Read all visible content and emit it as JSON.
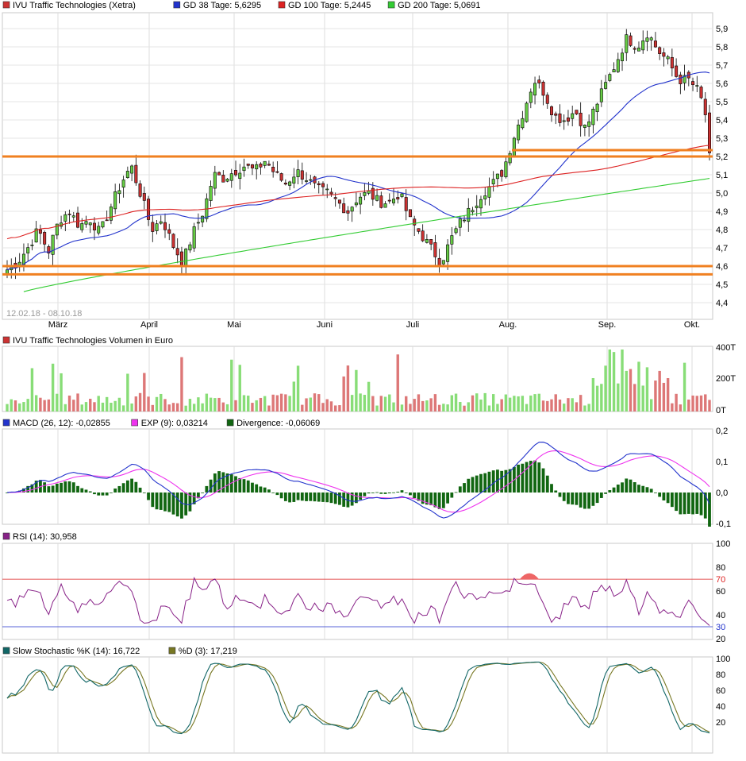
{
  "colors": {
    "up": "#66cc44",
    "down": "#cc3333",
    "gd38": "#2233cc",
    "gd100": "#dd2222",
    "gd200": "#33cc33",
    "hline": "#f08020",
    "vol_up": "#88dd77",
    "vol_down": "#dd7777",
    "macd": "#2233cc",
    "exp": "#ee33ee",
    "divergence": "#116611",
    "rsi": "#882288",
    "slowk": "#116666",
    "slowd": "#777722"
  },
  "price": {
    "legend": [
      {
        "text": "IVU Traffic Technologies (Xetra)",
        "color": "#cc3333"
      },
      {
        "text": "GD 38 Tage: 5,6295",
        "color": "#2233cc"
      },
      {
        "text": "GD 100 Tage: 5,2445",
        "color": "#dd2222"
      },
      {
        "text": "GD 200 Tage: 5,0691",
        "color": "#33cc33"
      }
    ],
    "range": "12.02.18 - 08.10.18",
    "yticks": [
      "5,9",
      "5,8",
      "5,7",
      "5,6",
      "5,5",
      "5,4",
      "5,3",
      "5,2",
      "5,1",
      "5,0",
      "4,9",
      "4,8",
      "4,7",
      "4,6",
      "4,5",
      "4,4"
    ],
    "xticks": [
      "März",
      "April",
      "Mai",
      "Juni",
      "Juli",
      "Aug.",
      "Sep.",
      "Okt."
    ]
  },
  "volume": {
    "legend": [
      {
        "text": "IVU Traffic Technologies Volumen in Euro",
        "color": "#cc3333"
      }
    ],
    "yticks": [
      "400T",
      "200T",
      "0T"
    ]
  },
  "macd": {
    "legend": [
      {
        "text": "MACD (26, 12): -0,02855",
        "color": "#2233cc"
      },
      {
        "text": "EXP (9): 0,03214",
        "color": "#ee33ee"
      },
      {
        "text": "Divergence: -0,06069",
        "color": "#116611"
      }
    ],
    "yticks": [
      "0,2",
      "0,1",
      "0,0",
      "-0,1"
    ]
  },
  "rsi": {
    "legend": [
      {
        "text": "RSI (14): 30,958",
        "color": "#882288"
      }
    ],
    "yticks": [
      "100",
      "80",
      "70",
      "60",
      "40",
      "30",
      "20"
    ]
  },
  "stoch": {
    "legend": [
      {
        "text": "Slow Stochastic %K (14): 16,722",
        "color": "#116666"
      },
      {
        "text": "%D (3): 17,219",
        "color": "#777722"
      }
    ],
    "yticks": [
      "100",
      "80",
      "60",
      "40",
      "20"
    ]
  },
  "chart_data": [
    {
      "type": "candlestick",
      "title": "IVU Traffic Technologies (Xetra)",
      "ylim": [
        4.4,
        5.95
      ],
      "hlines": [
        5.2,
        4.6,
        4.555,
        5.235
      ],
      "x": [
        "März",
        "April",
        "Mai",
        "Juni",
        "Juli",
        "Aug.",
        "Sep.",
        "Okt."
      ],
      "close_path": [
        4.58,
        4.62,
        4.7,
        4.8,
        4.68,
        4.85,
        4.9,
        4.82,
        4.86,
        4.78,
        4.92,
        5.05,
        5.15,
        4.98,
        4.8,
        4.86,
        4.72,
        4.62,
        4.78,
        4.9,
        5.1,
        5.08,
        5.12,
        5.15,
        5.12,
        5.18,
        5.1,
        5.05,
        5.12,
        5.08,
        5.02,
        5.0,
        4.95,
        4.9,
        4.98,
        5.0,
        4.95,
        4.95,
        5.0,
        4.85,
        4.78,
        4.7,
        4.62,
        4.75,
        4.85,
        4.92,
        5.0,
        5.05,
        5.12,
        5.3,
        5.45,
        5.62,
        5.55,
        5.42,
        5.4,
        5.45,
        5.35,
        5.48,
        5.6,
        5.72,
        5.85,
        5.8,
        5.88,
        5.78,
        5.72,
        5.62,
        5.62,
        5.55,
        5.35
      ],
      "series": [
        {
          "name": "GD 38 Tage",
          "value": 5.6295
        },
        {
          "name": "GD 100 Tage",
          "value": 5.2445
        },
        {
          "name": "GD 200 Tage",
          "value": 5.0691
        }
      ]
    },
    {
      "type": "bar",
      "title": "IVU Traffic Technologies Volumen in Euro",
      "ylim": [
        0,
        400
      ]
    },
    {
      "type": "line",
      "title": "MACD",
      "ylim": [
        -0.1,
        0.2
      ],
      "series": [
        {
          "name": "MACD (26, 12)",
          "value": -0.02855
        },
        {
          "name": "EXP (9)",
          "value": 0.03214
        },
        {
          "name": "Divergence",
          "value": -0.06069
        }
      ]
    },
    {
      "type": "line",
      "title": "RSI (14)",
      "ylim": [
        20,
        100
      ],
      "value": 30.958,
      "levels": [
        70,
        30
      ]
    },
    {
      "type": "line",
      "title": "Slow Stochastic",
      "ylim": [
        0,
        100
      ],
      "series": [
        {
          "name": "%K (14)",
          "value": 16.722
        },
        {
          "name": "%D (3)",
          "value": 17.219
        }
      ]
    }
  ]
}
